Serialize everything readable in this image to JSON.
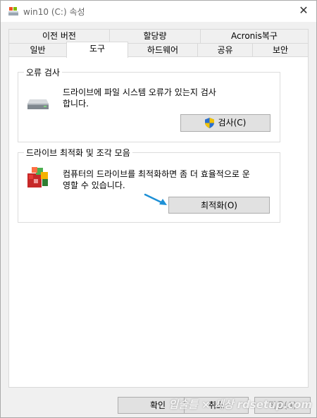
{
  "window": {
    "title": "win10 (C:) 속성",
    "close_glyph": "✕"
  },
  "tabs_row1": [
    {
      "label": "이전 버전"
    },
    {
      "label": "할당량"
    },
    {
      "label": "Acronis복구"
    }
  ],
  "tabs_row2": [
    {
      "label": "일반"
    },
    {
      "label": "도구",
      "active": true
    },
    {
      "label": "하드웨어"
    },
    {
      "label": "공유"
    },
    {
      "label": "보안"
    }
  ],
  "error_check": {
    "title": "오류 검사",
    "description_line1": "드라이브에 파일 시스템 오류가 있는지 검사",
    "description_line2": "합니다.",
    "button_label": "검사(C)",
    "icon": "drive-icon"
  },
  "defrag": {
    "title": "드라이브 최적화 및 조각 모음",
    "description_line1": "컴퓨터의 드라이브를 최적화하면 좀 더 효율적으로 운",
    "description_line2": "영할 수 있습니다.",
    "button_label": "최적화(O)",
    "icon": "defrag-icon"
  },
  "footer": {
    "ok_label": "확인",
    "cancel_label": "취소",
    "apply_label": "적용(A)"
  },
  "watermark": "입술틀 × 세상 rdsetup.com",
  "colors": {
    "accent_arrow": "#1e90d6",
    "shield_blue": "#2a6fcf",
    "shield_yellow": "#f2c200"
  }
}
